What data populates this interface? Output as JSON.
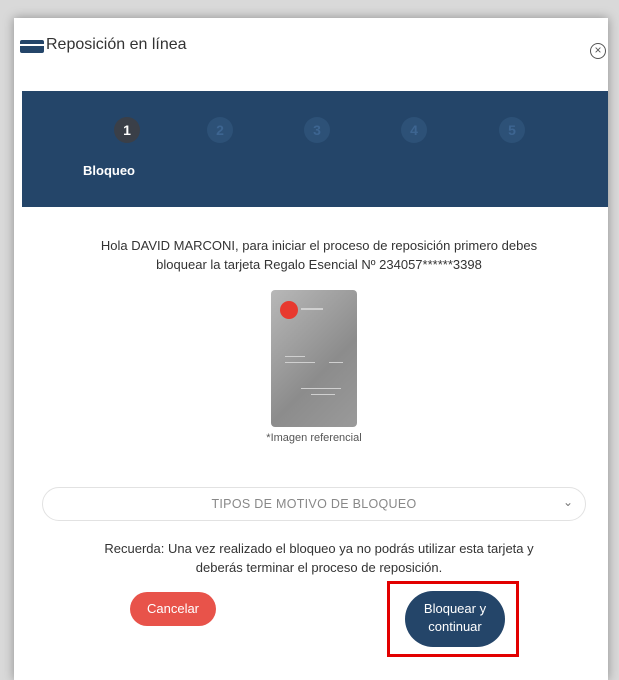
{
  "header": {
    "title": "Reposición en línea",
    "title_icon": "card-icon",
    "close_icon": "close-circle-icon"
  },
  "stepper": {
    "steps": [
      "1",
      "2",
      "3",
      "4",
      "5"
    ],
    "active_step": 1,
    "active_label": "Bloqueo"
  },
  "main": {
    "intro_line1": "Hola DAVID MARCONI, para iniciar el proceso de reposición primero debes",
    "intro_line2": "bloquear la tarjeta Regalo Esencial Nº 234057******3398",
    "image_caption": "*Imagen referencial",
    "select_placeholder": "TIPOS DE MOTIVO DE BLOQUEO",
    "reminder_line1": "Recuerda: Una vez realizado el bloqueo ya no podrás utilizar esta tarjeta y",
    "reminder_line2": "deberás terminar el proceso de reposición."
  },
  "buttons": {
    "cancel": "Cancelar",
    "continue_line1": "Bloquear y",
    "continue_line2": "continuar"
  },
  "colors": {
    "primary": "#244569",
    "cancel": "#e8534a",
    "highlight": "#e20000"
  }
}
